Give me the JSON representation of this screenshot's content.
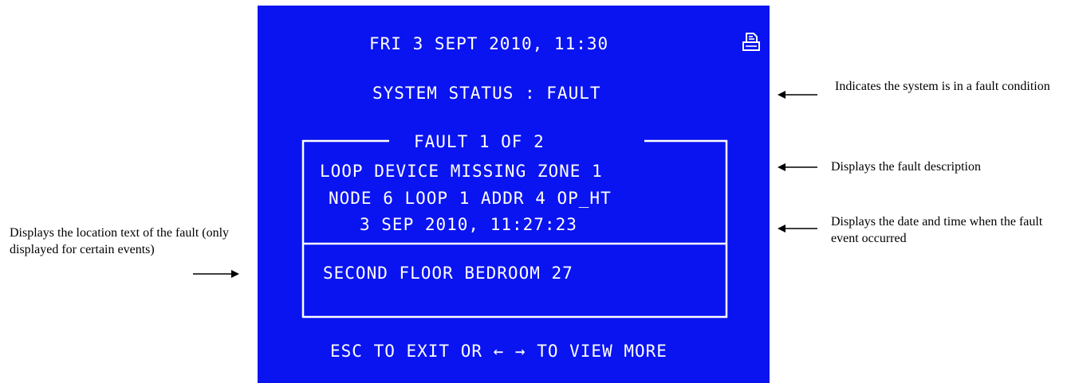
{
  "screen": {
    "datetime": "FRI 3 SEPT 2010, 11:30",
    "status": "SYSTEM STATUS : FAULT",
    "fault_counter": "FAULT 1 OF 2",
    "fault_description": "LOOP DEVICE MISSING ZONE 1",
    "fault_address": "NODE 6 LOOP 1 ADDR 4 OP_HT",
    "fault_timestamp": "3 SEP 2010, 11:27:23",
    "location_text": "SECOND FLOOR BEDROOM 27",
    "footer": "ESC TO EXIT OR ← → TO VIEW MORE",
    "icon": "printer-icon"
  },
  "annotations": {
    "status": "Indicates the system is in a fault condition",
    "description": "Displays the fault description",
    "datetime": "Displays the date and time when the fault event occurred",
    "location": "Displays the location text of the fault (only displayed for certain events)"
  },
  "colors": {
    "screen_background": "#0a14f0",
    "screen_text": "#ffffff",
    "page_background": "#ffffff"
  }
}
